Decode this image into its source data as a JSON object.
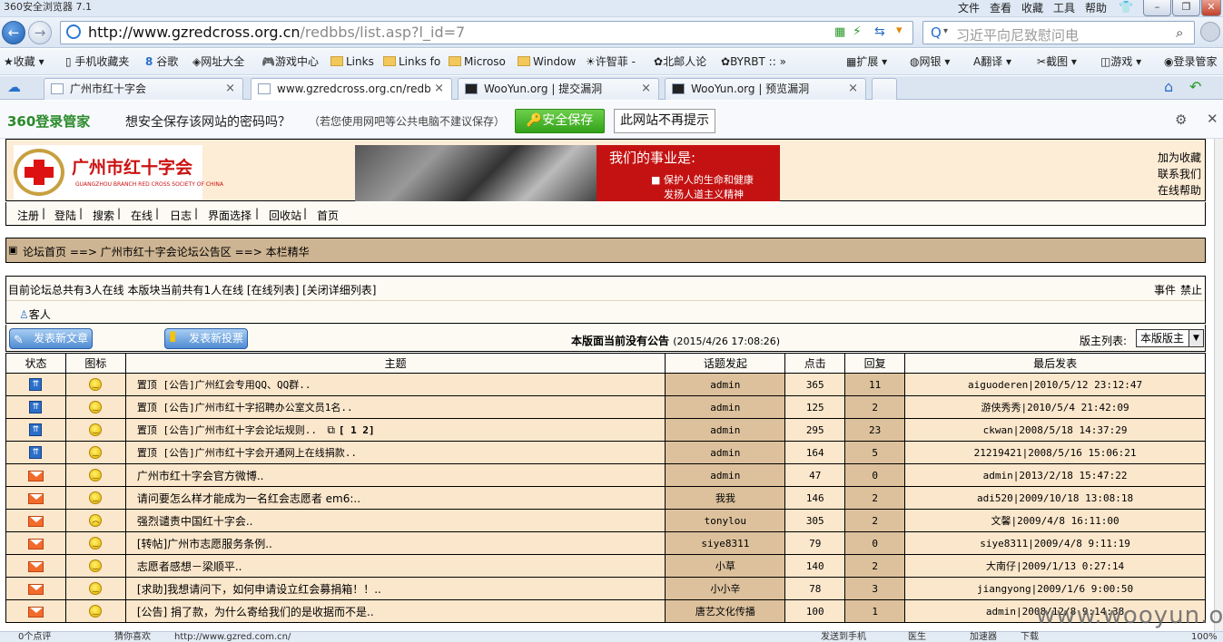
{
  "browser": {
    "title": "360安全浏览器 7.1",
    "menu": [
      "文件",
      "查看",
      "收藏",
      "工具",
      "帮助"
    ],
    "url_host": "http://www.gzredcross.org.cn",
    "url_path": "/redbbs/list.asp?l_id=7",
    "search_placeholder": "习近平向尼致慰问电",
    "bookmarks": [
      "收藏",
      "手机收藏夹",
      "谷歌",
      "网址大全",
      "游戏中心",
      "Links",
      "Links fo",
      "Microso",
      "Window",
      "许智菲 -",
      "北邮人论",
      "BYRBT ::",
      "扩展",
      "网银",
      "翻译",
      "截图",
      "游戏",
      "登录管家"
    ],
    "tabs": [
      {
        "label": "广州市红十字会"
      },
      {
        "label": "www.gzredcross.org.cn/redb"
      },
      {
        "label": "WooYun.org | 提交漏洞"
      },
      {
        "label": "WooYun.org | 预览漏洞"
      }
    ],
    "status_left": "0个点评",
    "status_mid": "猜你喜欢",
    "status_url": "http://www.gzred.com.cn/",
    "status_right": [
      "发送到手机",
      "医生",
      "加速器",
      "下载",
      "100%"
    ]
  },
  "password_prompt": {
    "logo": "360登录管家",
    "message": "想安全保存该网站的密码吗？",
    "note": "（若您使用网吧等公共电脑不建议保存）",
    "save_label": "安全保存",
    "never_label": "此网站不再提示"
  },
  "site": {
    "logo_text": "广州市红十字会",
    "logo_sub": "GUANGZHOU BRANCH RED CROSS SOCIETY OF CHINA",
    "banner_title": "我们的事业是:",
    "banner_line1": "■ 保护人的生命和健康",
    "banner_line2": "发扬人道主义精神",
    "right_links": [
      "加为收藏",
      "联系我们",
      "在线帮助"
    ],
    "nav": [
      "注册",
      "登陆",
      "搜索",
      "在线",
      "日志",
      "界面选择",
      "回收站",
      "首页"
    ],
    "breadcrumb": "论坛首页 ==> 广州市红十字会论坛公告区 ==> 本栏精华",
    "online_text": "目前论坛总共有3人在线 本版块当前共有1人在线 [在线列表] [关闭详细列表]",
    "online_actions": [
      "事件",
      "禁止"
    ],
    "guest_label": "客人",
    "post_article": "发表新文章",
    "post_vote": "发表新投票",
    "notice": "本版面当前没有公告",
    "notice_time": "(2015/4/26 17:08:26)",
    "moderator_label": "版主列表:",
    "moderator_select": "本版版主"
  },
  "table": {
    "headers": [
      "状态",
      "图标",
      "主题",
      "话题发起",
      "点击",
      "回复",
      "最后发表"
    ],
    "rows": [
      {
        "status": "top",
        "icon": "smile",
        "topic": "置顶 [公告]广州红会专用QQ、QQ群..",
        "author": "admin",
        "clicks": "365",
        "replies": "11",
        "last": "aiguoderen|2010/5/12 23:12:47"
      },
      {
        "status": "top",
        "icon": "smile",
        "topic": "置顶 [公告]广州市红十字招聘办公室文员1名..",
        "author": "admin",
        "clicks": "125",
        "replies": "2",
        "last": "游侠秀秀|2010/5/4 21:42:09"
      },
      {
        "status": "top",
        "icon": "smile",
        "topic": "置顶 [公告]广州市红十字会论坛规则..",
        "pages": "[ 1 2]",
        "author": "admin",
        "clicks": "295",
        "replies": "23",
        "last": "ckwan|2008/5/18 14:37:29"
      },
      {
        "status": "top",
        "icon": "smile",
        "topic": "置顶 [公告]广州市红十字会开通网上在线捐款..",
        "author": "admin",
        "clicks": "164",
        "replies": "5",
        "last": "21219421|2008/5/16 15:06:21"
      },
      {
        "status": "mail",
        "icon": "smile",
        "topic": "广州市红十字会官方微博..",
        "author": "admin",
        "clicks": "47",
        "replies": "0",
        "last": "admin|2013/2/18 15:47:22"
      },
      {
        "status": "mail",
        "icon": "smile",
        "topic": "请问要怎么样才能成为一名红会志愿者 em6:..",
        "author": "我我",
        "clicks": "146",
        "replies": "2",
        "last": "adi520|2009/10/18 13:08:18"
      },
      {
        "status": "mail",
        "icon": "sad",
        "topic": "强烈谴责中国红十字会..",
        "author": "tonylou",
        "clicks": "305",
        "replies": "2",
        "last": "文馨|2009/4/8 16:11:00"
      },
      {
        "status": "mail",
        "icon": "smile",
        "topic": "[转帖]广州市志愿服务条例..",
        "author": "siye8311",
        "clicks": "79",
        "replies": "0",
        "last": "siye8311|2009/4/8 9:11:19"
      },
      {
        "status": "mail",
        "icon": "smile",
        "topic": "志愿者感想－梁顺平..",
        "author": "小草",
        "clicks": "140",
        "replies": "2",
        "last": "大南仔|2009/1/13 0:27:14"
      },
      {
        "status": "mail",
        "icon": "smile",
        "topic": "[求助]我想请问下，如何申请设立红会募捐箱！！..",
        "author": "小小辛",
        "clicks": "78",
        "replies": "3",
        "last": "jiangyong|2009/1/6 9:00:50"
      },
      {
        "status": "mail",
        "icon": "smile",
        "topic": "[公告] 捐了款，为什么寄给我们的是收据而不是..",
        "author": "唐艺文化传播",
        "clicks": "100",
        "replies": "1",
        "last": "admin|2008/12/8 9:14:38"
      }
    ]
  },
  "watermark": "www.wooyun.org"
}
